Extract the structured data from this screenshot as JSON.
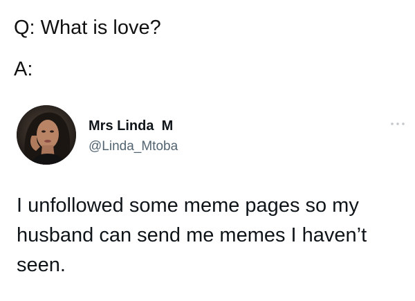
{
  "question": "Q: What is love?",
  "answer": "A:",
  "tweet": {
    "display_name": "Mrs Linda  M",
    "handle": "@Linda_Mtoba",
    "text": "I unfollowed some meme pages so my husband can send me memes I haven’t seen.",
    "avatar_icon": "profile-photo",
    "more_icon": "ellipsis-icon"
  },
  "colors": {
    "text": "#0f1419",
    "handle": "#536471",
    "background": "#ffffff"
  }
}
